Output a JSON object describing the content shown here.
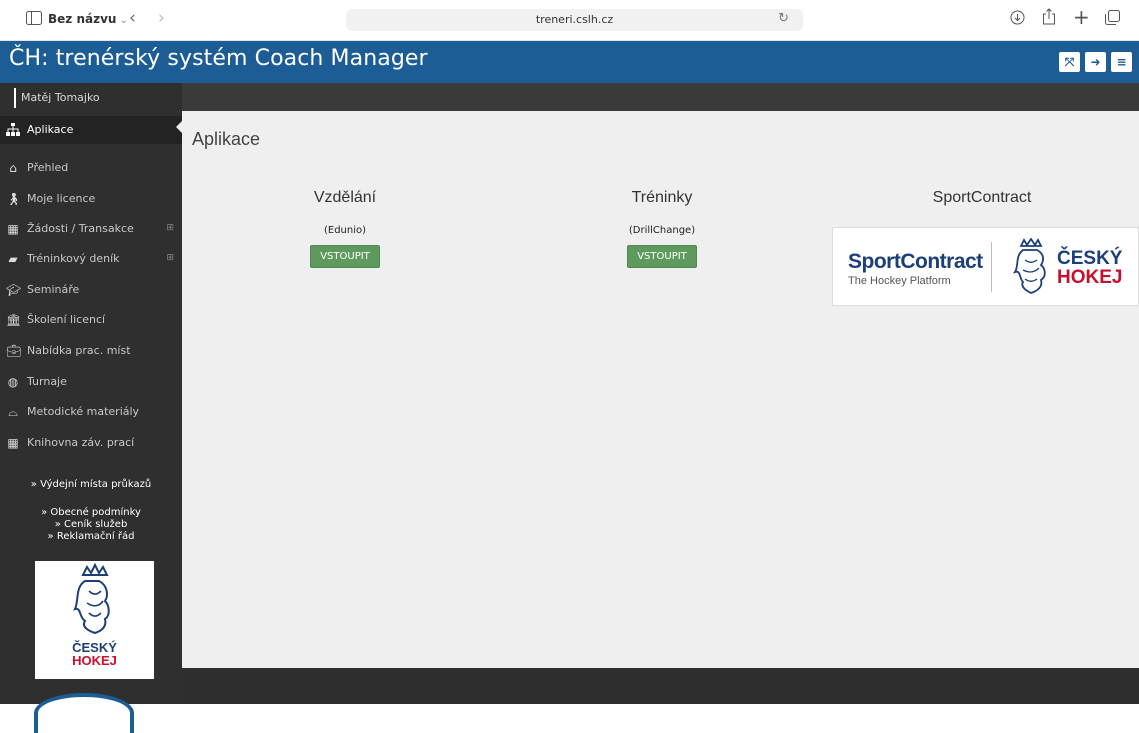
{
  "browser": {
    "tab_title": "Bez názvu",
    "url": "treneri.cslh.cz"
  },
  "app": {
    "title": "ČH: trenérský systém Coach Manager"
  },
  "sidebar": {
    "user_name": "Matěj Tomajko",
    "items": [
      {
        "label": "Aplikace",
        "icon": "sitemap-icon",
        "active": true,
        "expandable": false
      },
      {
        "label": "Přehled",
        "icon": "home-icon",
        "active": false,
        "expandable": false
      },
      {
        "label": "Moje licence",
        "icon": "person-icon",
        "active": false,
        "expandable": false
      },
      {
        "label": "Žádosti / Transakce",
        "icon": "table-icon",
        "active": false,
        "expandable": true
      },
      {
        "label": "Tréninkový deník",
        "icon": "book-icon",
        "active": false,
        "expandable": true
      },
      {
        "label": "Semináře",
        "icon": "graduation-cap-icon",
        "active": false,
        "expandable": false
      },
      {
        "label": "Školení licencí",
        "icon": "institution-icon",
        "active": false,
        "expandable": false
      },
      {
        "label": "Nabídka prac. míst",
        "icon": "briefcase-icon",
        "active": false,
        "expandable": false
      },
      {
        "label": "Turnaje",
        "icon": "globe-icon",
        "active": false,
        "expandable": false
      },
      {
        "label": "Metodické materiály",
        "icon": "inbox-icon",
        "active": false,
        "expandable": false
      },
      {
        "label": "Knihovna záv. prací",
        "icon": "table-icon",
        "active": false,
        "expandable": false
      }
    ],
    "links": {
      "vydejni": "» Výdejní místa průkazů",
      "obecne": "» Obecné podmínky",
      "cenik": "» Ceník služeb",
      "reklamacni": "» Reklamační řád"
    },
    "logo": {
      "line1": "ČESKÝ",
      "line2": "HOKEJ"
    }
  },
  "main": {
    "page_title": "Aplikace",
    "apps": [
      {
        "title": "Vzdělání",
        "subtitle": "(Edunio)",
        "button": "VSTOUPIT"
      },
      {
        "title": "Tréninky",
        "subtitle": "(DrillChange)",
        "button": "VSTOUPIT"
      },
      {
        "title": "SportContract"
      }
    ],
    "sportcontract_banner": {
      "wordmark": "SportContract",
      "tagline": "The Hockey Platform",
      "partner_line1": "ČESKÝ",
      "partner_line2": "HOKEJ"
    }
  },
  "colors": {
    "header_blue": "#1c5d96",
    "sidebar_dark": "#2f2f2f",
    "button_green": "#5e9a5e",
    "hokej_red": "#c8102e",
    "hokej_blue": "#1c3f7a"
  }
}
